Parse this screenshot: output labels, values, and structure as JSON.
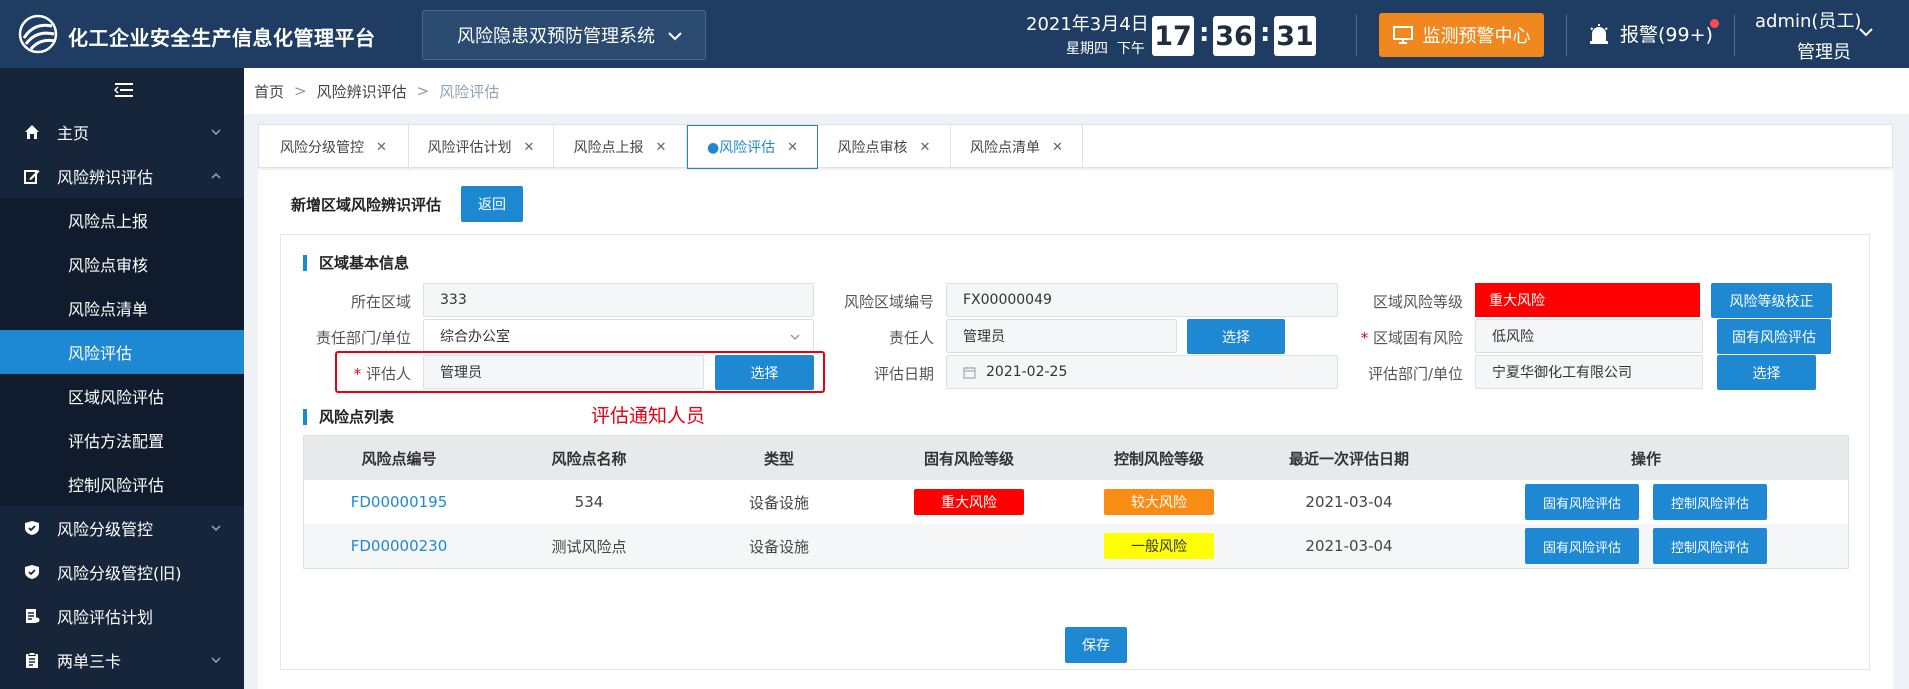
{
  "header": {
    "app_title": "化工企业安全生产信息化管理平台",
    "system_name": "风险隐患双预防管理系统",
    "date": "2021年3月4日",
    "weekday": "星期四",
    "ampm": "下午",
    "clock": {
      "hour": "17",
      "minute": "36",
      "second": "31"
    },
    "monitor_label": "监测预警中心",
    "alarm_label": "报警(99+)",
    "user_name": "admin(员工)",
    "user_role": "管理员"
  },
  "sidebar": {
    "items": [
      {
        "label": "主页",
        "icon": "home-icon"
      },
      {
        "label": "风险辨识评估",
        "icon": "edit-icon"
      },
      {
        "label": "风险分级管控",
        "icon": "shield-icon"
      },
      {
        "label": "风险分级管控(旧)",
        "icon": "shield-icon"
      },
      {
        "label": "风险评估计划",
        "icon": "doc-list-icon"
      },
      {
        "label": "两单三卡",
        "icon": "clipboard-icon"
      }
    ],
    "subitems": [
      {
        "label": "风险点上报"
      },
      {
        "label": "风险点审核"
      },
      {
        "label": "风险点清单"
      },
      {
        "label": "风险评估"
      },
      {
        "label": "区域风险评估"
      },
      {
        "label": "评估方法配置"
      },
      {
        "label": "控制风险评估"
      }
    ]
  },
  "breadcrumb": {
    "home": "首页",
    "parent": "风险辨识评估",
    "current": "风险评估"
  },
  "tabs": [
    {
      "label": "风险分级管控"
    },
    {
      "label": "风险评估计划"
    },
    {
      "label": "风险点上报"
    },
    {
      "label": "●风险评估"
    },
    {
      "label": "风险点审核"
    },
    {
      "label": "风险点清单"
    }
  ],
  "page": {
    "title": "新增区域风险辨识评估",
    "back_label": "返回",
    "save_label": "保存"
  },
  "basic_info": {
    "section_title": "区域基本信息",
    "area_label": "所在区域",
    "area_value": "333",
    "code_label": "风险区域编号",
    "code_value": "FX00000049",
    "level_label": "区域风险等级",
    "level_value": "重大风险",
    "level_check_label": "风险等级校正",
    "dept_label": "责任部门/单位",
    "dept_value": "综合办公室",
    "owner_label": "责任人",
    "owner_value": "管理员",
    "owner_select_label": "选择",
    "inherent_label": "区域固有风险",
    "inherent_value": "低风险",
    "inherent_btn_label": "固有风险评估",
    "assessor_label": "评估人",
    "assessor_value": "管理员",
    "assessor_select_label": "选择",
    "date_label": "评估日期",
    "date_value": "2021-02-25",
    "eval_dept_label": "评估部门/单位",
    "eval_dept_value": "宁夏华御化工有限公司",
    "eval_dept_select_label": "选择",
    "required_mark": "*"
  },
  "annotation": "评估通知人员",
  "risk_table": {
    "section_title": "风险点列表",
    "columns": [
      "风险点编号",
      "风险点名称",
      "类型",
      "固有风险等级",
      "控制风险等级",
      "最近一次评估日期",
      "操作"
    ],
    "rows": [
      {
        "code": "FD00000195",
        "name": "534",
        "type": "设备设施",
        "inherent": "重大风险",
        "control": "较大风险",
        "date": "2021-03-04",
        "op1": "固有风险评估",
        "op2": "控制风险评估"
      },
      {
        "code": "FD00000230",
        "name": "测试风险点",
        "type": "设备设施",
        "inherent": "",
        "control": "一般风险",
        "date": "2021-03-04",
        "op1": "固有风险评估",
        "op2": "控制风险评估"
      }
    ]
  },
  "colors": {
    "header_bg": "#1f3d62",
    "sidebar_bg": "#16253a",
    "accent": "#1e88d3",
    "monitor": "#f0871f",
    "risk_major": "#ff0000",
    "risk_large": "#fa8c16",
    "risk_general": "#ffff00"
  }
}
